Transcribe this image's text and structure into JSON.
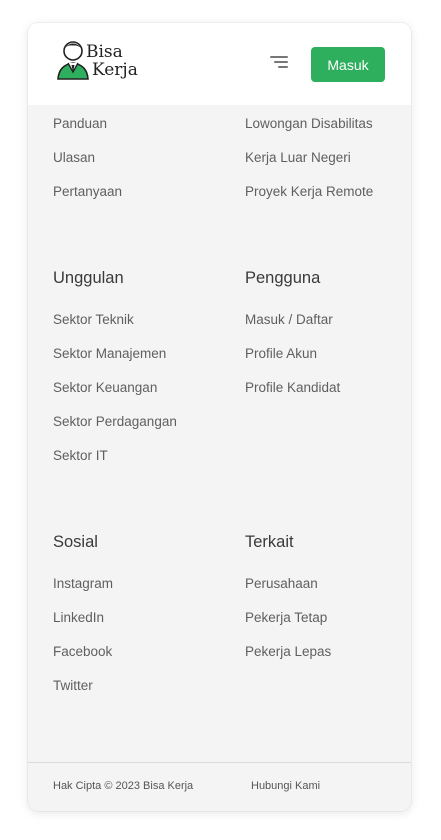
{
  "header": {
    "logo": {
      "line1": "Bisa",
      "line2": "Kerja",
      "icon": "worker-avatar-icon"
    },
    "menu_icon": "hamburger-menu-icon",
    "login_label": "Masuk"
  },
  "colors": {
    "accent": "#2eaf5e",
    "background": "#f4f4f4",
    "header": "#ffffff"
  },
  "top_links": {
    "left": [
      "Panduan",
      "Ulasan",
      "Pertanyaan"
    ],
    "right": [
      "Lowongan Disabilitas",
      "Kerja Luar Negeri",
      "Proyek Kerja Remote"
    ]
  },
  "sections": {
    "unggulan": {
      "title": "Unggulan",
      "items": [
        "Sektor Teknik",
        "Sektor Manajemen",
        "Sektor Keuangan",
        "Sektor Perdagangan",
        "Sektor IT"
      ]
    },
    "pengguna": {
      "title": "Pengguna",
      "items": [
        "Masuk / Daftar",
        "Profile Akun",
        "Profile Kandidat"
      ]
    },
    "sosial": {
      "title": "Sosial",
      "items": [
        "Instagram",
        "LinkedIn",
        "Facebook",
        "Twitter"
      ]
    },
    "terkait": {
      "title": "Terkait",
      "items": [
        "Perusahaan",
        "Pekerja Tetap",
        "Pekerja Lepas"
      ]
    }
  },
  "footer": {
    "copyright": "Hak Cipta © 2023 Bisa Kerja",
    "contact": "Hubungi Kami"
  }
}
